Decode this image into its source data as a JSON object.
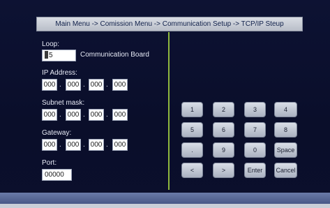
{
  "title": "Main Menu -> Comission Menu -> Communication Setup -> TCP/IP Steup",
  "loop": {
    "label": "Loop:",
    "value": "5",
    "suffix": "Communication Board"
  },
  "ip": {
    "label": "IP Address:",
    "octets": [
      "000",
      "000",
      "000",
      "000"
    ]
  },
  "subnet": {
    "label": "Subnet mask:",
    "octets": [
      "000",
      "000",
      "000",
      "000"
    ]
  },
  "gateway": {
    "label": "Gateway:",
    "octets": [
      "000",
      "000",
      "000",
      "000"
    ]
  },
  "port": {
    "label": "Port:",
    "value": "00000"
  },
  "separator": ".",
  "keypad": {
    "row1": [
      "1",
      "2",
      "3",
      "4"
    ],
    "row2": [
      "5",
      "6",
      "7",
      "8"
    ],
    "row3": [
      ".",
      "9",
      "0",
      "Space"
    ],
    "row4": [
      "<",
      ">",
      "Enter",
      "Cancel"
    ]
  },
  "colors": {
    "background": "#0b0f2e",
    "divider": "#8fb83e",
    "key": "#c3c9d4"
  }
}
